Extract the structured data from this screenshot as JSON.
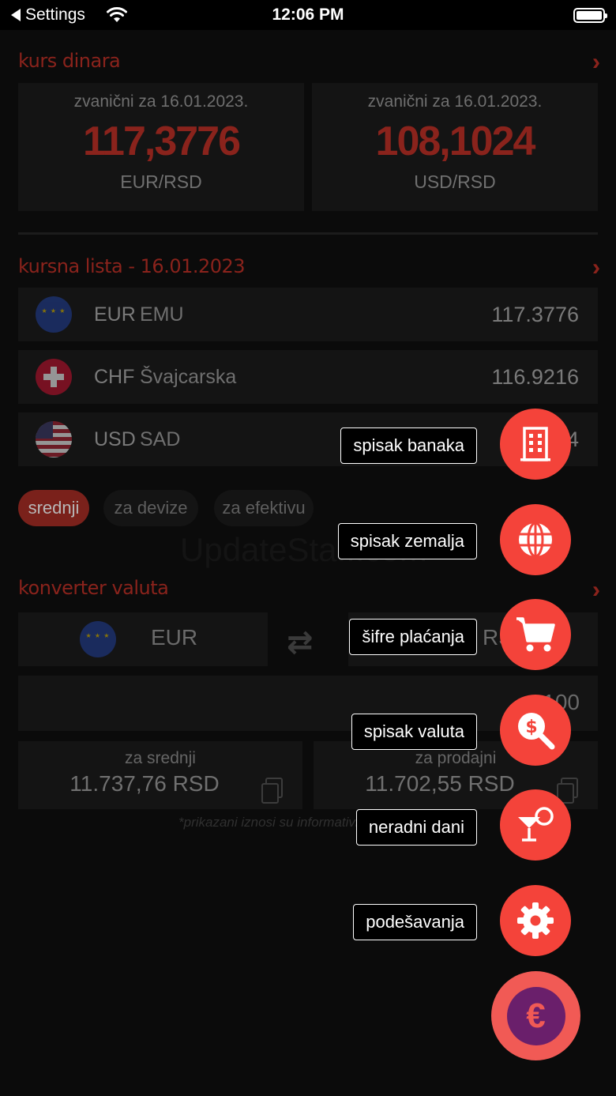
{
  "status_bar": {
    "back_label": "Settings",
    "time": "12:06 PM"
  },
  "kurs": {
    "title": "kurs dinara",
    "cards": [
      {
        "label": "zvanični za 16.01.2023.",
        "value": "117,3776",
        "pair": "EUR/RSD"
      },
      {
        "label": "zvanični za 16.01.2023.",
        "value": "108,1024",
        "pair": "USD/RSD"
      }
    ]
  },
  "lista": {
    "title": "kursna lista - 16.01.2023",
    "rows": [
      {
        "code": "EUR",
        "country": "EMU",
        "value": "117.3776",
        "flag": "eu-flag-icon"
      },
      {
        "code": "CHF",
        "country": "Švajcarska",
        "value": "116.9216",
        "flag": "swiss-flag-icon"
      },
      {
        "code": "USD",
        "country": "SAD",
        "value": "4",
        "flag": "us-flag-icon"
      }
    ],
    "tabs": [
      "srednji",
      "za devize",
      "za efektivu"
    ],
    "active_tab": "srednji"
  },
  "watermark": "UpdateSta...com",
  "konverter": {
    "title": "konverter valuta",
    "from_currency": "EUR",
    "to_currency": "RS",
    "amount": "100",
    "results": [
      {
        "label": "za srednji",
        "value": "11.737,76 RSD"
      },
      {
        "label": "za prodajni",
        "value": "11.702,55 RSD"
      }
    ],
    "disclaimer": "*prikazani iznosi su informativni"
  },
  "fab_menu": [
    {
      "label": "spisak banaka",
      "icon": "bank-building-icon"
    },
    {
      "label": "spisak zemalja",
      "icon": "globe-icon"
    },
    {
      "label": "šifre plaćanja",
      "icon": "shopping-cart-icon"
    },
    {
      "label": "spisak valuta",
      "icon": "currency-search-icon"
    },
    {
      "label": "neradni dani",
      "icon": "cocktail-icon"
    },
    {
      "label": "podešavanja",
      "icon": "gear-icon"
    }
  ],
  "fab_main": {
    "symbol": "€",
    "icon": "euro-icon"
  },
  "colors": {
    "accent": "#8a231c",
    "fab": "#f4433a",
    "fab_main_inner": "#6a1f6b",
    "background": "#0b0b0b"
  }
}
